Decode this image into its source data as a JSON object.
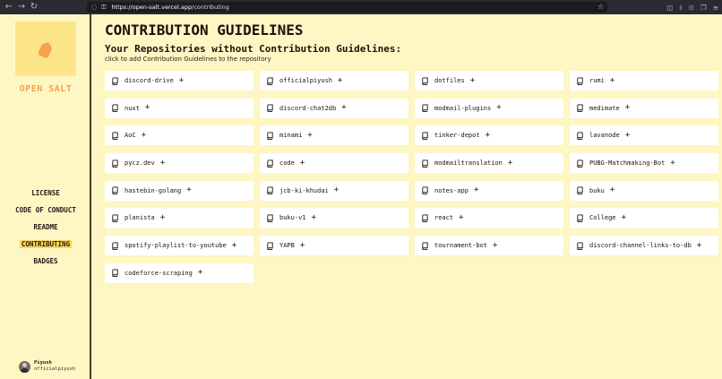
{
  "browser": {
    "url_host": "https://open-salt.vercel.app",
    "url_path": "/contributing"
  },
  "sidebar": {
    "brand": "OPEN SALT",
    "nav": [
      "LICENSE",
      "CODE OF CONDUCT",
      "README",
      "CONTRIBUTING",
      "BADGES"
    ],
    "active_index": 3,
    "profile": {
      "name": "Piyush",
      "username": "officialpiyush"
    }
  },
  "main": {
    "title": "CONTRIBUTION GUIDELINES",
    "section_title": "Your Repositories without Contribution Guidelines:",
    "hint": "click to add Contribution Guidelines to the repository",
    "repos": [
      "discord-drive",
      "officialpiyush",
      "dotfiles",
      "rumi",
      "nuxt",
      "discord-chat2db",
      "modmail-plugins",
      "medimate",
      "AoC",
      "minami",
      "tinker-depot",
      "lavanode",
      "pycz.dev",
      "code",
      "modmailtranslation",
      "PUBG-Matchmaking-Bot",
      "hastebin-golang",
      "jcb-ki-khudai",
      "notes-app",
      "buku",
      "planista",
      "buku-v1",
      "react",
      "College",
      "spotify-playlist-to-youtube",
      "YAPB",
      "tournament-bot",
      "discord-channel-links-to-db",
      "codeforce-scraping"
    ],
    "add_symbol": "+"
  },
  "colors": {
    "background": "#fef6c3",
    "logo_bg": "#fde58a",
    "brand": "#f5a24b",
    "active_highlight": "#fcd85a",
    "card": "#ffffff"
  }
}
